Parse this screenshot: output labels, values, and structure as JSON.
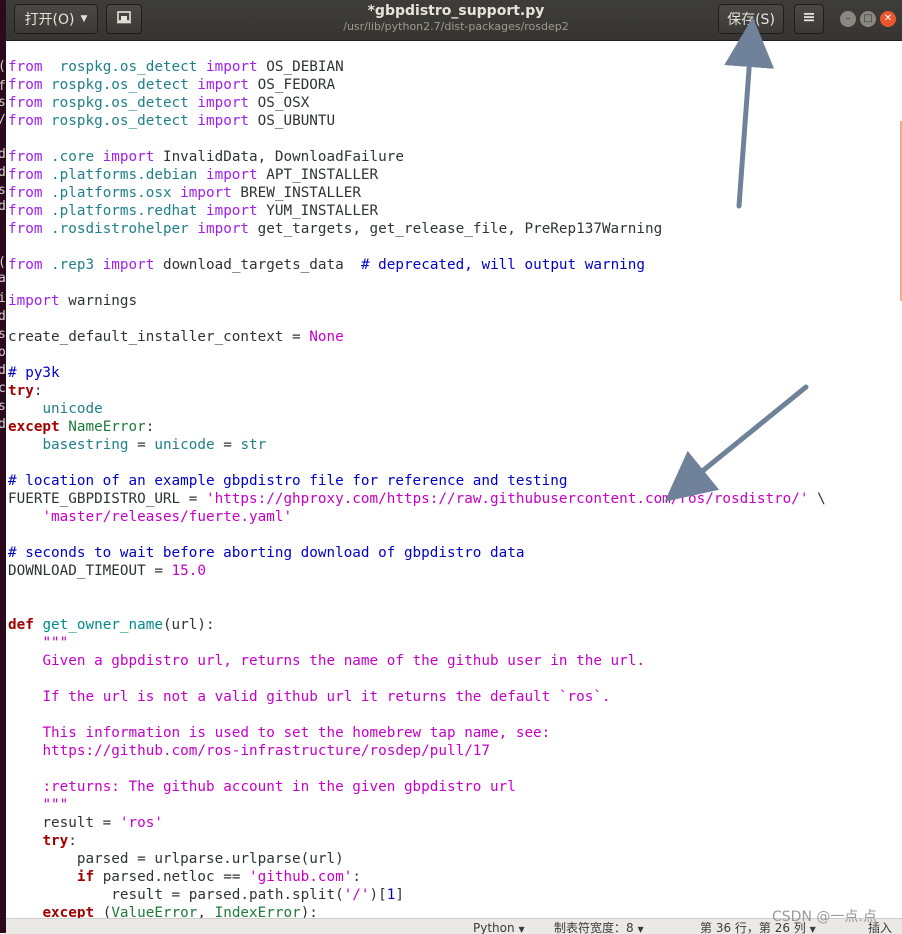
{
  "window": {
    "title": "*gbpdistro_support.py",
    "path": "/usr/lib/python2.7/dist-packages/rosdep2"
  },
  "toolbar": {
    "open_label": "打开(O)",
    "save_label": "保存(S)"
  },
  "icons": {
    "open_caret": "chevron-down-icon",
    "pin": "pin-document-icon",
    "menu": "hamburger-menu-icon",
    "minimize": "minimize-icon",
    "maximize": "maximize-icon",
    "close": "close-icon"
  },
  "left_strip_glyphs": [
    "(",
    "f",
    "s",
    "/",
    "d",
    "d",
    "s",
    "d",
    "(",
    "a",
    "i",
    "d",
    "s",
    "o",
    "d",
    "c",
    "s",
    "d"
  ],
  "code_lines": [
    [
      [
        "im",
        "from"
      ],
      [
        "",
        "  "
      ],
      [
        "mod",
        "rospkg.os_detect"
      ],
      [
        "",
        ""
      ],
      [
        "im",
        " import"
      ],
      [
        "",
        " OS_DEBIAN"
      ]
    ],
    [
      [
        "im",
        "from"
      ],
      [
        "",
        " "
      ],
      [
        "mod",
        "rospkg.os_detect"
      ],
      [
        "im",
        " import"
      ],
      [
        "",
        " OS_FEDORA"
      ]
    ],
    [
      [
        "im",
        "from"
      ],
      [
        "",
        " "
      ],
      [
        "mod",
        "rospkg.os_detect"
      ],
      [
        "im",
        " import"
      ],
      [
        "",
        " OS_OSX"
      ]
    ],
    [
      [
        "im",
        "from"
      ],
      [
        "",
        " "
      ],
      [
        "mod",
        "rospkg.os_detect"
      ],
      [
        "im",
        " import"
      ],
      [
        "",
        " OS_UBUNTU"
      ]
    ],
    [],
    [
      [
        "im",
        "from"
      ],
      [
        "",
        " "
      ],
      [
        "mod",
        ".core"
      ],
      [
        "im",
        " import"
      ],
      [
        "",
        " InvalidData, DownloadFailure"
      ]
    ],
    [
      [
        "im",
        "from"
      ],
      [
        "",
        " "
      ],
      [
        "mod",
        ".platforms.debian"
      ],
      [
        "im",
        " import"
      ],
      [
        "",
        " APT_INSTALLER"
      ]
    ],
    [
      [
        "im",
        "from"
      ],
      [
        "",
        " "
      ],
      [
        "mod",
        ".platforms.osx"
      ],
      [
        "im",
        " import"
      ],
      [
        "",
        " BREW_INSTALLER"
      ]
    ],
    [
      [
        "im",
        "from"
      ],
      [
        "",
        " "
      ],
      [
        "mod",
        ".platforms.redhat"
      ],
      [
        "im",
        " import"
      ],
      [
        "",
        " YUM_INSTALLER"
      ]
    ],
    [
      [
        "im",
        "from"
      ],
      [
        "",
        " "
      ],
      [
        "mod",
        ".rosdistrohelper"
      ],
      [
        "im",
        " import"
      ],
      [
        "",
        " get_targets, get_release_file, PreRep137Warning"
      ]
    ],
    [],
    [
      [
        "im",
        "from"
      ],
      [
        "",
        " "
      ],
      [
        "mod",
        ".rep3"
      ],
      [
        "im",
        " import"
      ],
      [
        "",
        " download_targets_data  "
      ],
      [
        "cm",
        "# deprecated, will output warning"
      ]
    ],
    [],
    [
      [
        "im",
        "import"
      ],
      [
        "",
        " warnings"
      ]
    ],
    [],
    [
      [
        "",
        "create_default_installer_context = "
      ],
      [
        "cst",
        "None"
      ]
    ],
    [],
    [
      [
        "cm",
        "# py3k"
      ]
    ],
    [
      [
        "kw",
        "try"
      ],
      [
        "",
        ":"
      ]
    ],
    [
      [
        "",
        "    "
      ],
      [
        "mod",
        "unicode"
      ]
    ],
    [
      [
        "kw",
        "except"
      ],
      [
        "",
        " "
      ],
      [
        "exc",
        "NameError"
      ],
      [
        "",
        ":"
      ]
    ],
    [
      [
        "",
        "    "
      ],
      [
        "mod",
        "basestring"
      ],
      [
        "",
        " = "
      ],
      [
        "mod",
        "unicode"
      ],
      [
        "",
        " = "
      ],
      [
        "mod",
        "str"
      ]
    ],
    [],
    [
      [
        "cm",
        "# location of an example gbpdistro file for reference and testing"
      ]
    ],
    [
      [
        "",
        "FUERTE_GBPDISTRO_URL = "
      ],
      [
        "str",
        "'https://ghproxy.com/https://raw.githubusercontent.com/ros/rosdistro/'"
      ],
      [
        "",
        " \\"
      ]
    ],
    [
      [
        "",
        "    "
      ],
      [
        "str",
        "'master/releases/fuerte.yaml'"
      ]
    ],
    [],
    [
      [
        "cm",
        "# seconds to wait before aborting download of gbpdistro data"
      ]
    ],
    [
      [
        "",
        "DOWNLOAD_TIMEOUT = "
      ],
      [
        "cst",
        "15.0"
      ]
    ],
    [],
    [],
    [
      [
        "kw",
        "def"
      ],
      [
        "",
        " "
      ],
      [
        "fn",
        "get_owner_name"
      ],
      [
        "",
        "(url):"
      ]
    ],
    [
      [
        "",
        "    "
      ],
      [
        "str",
        "\"\"\""
      ]
    ],
    [
      [
        "",
        "    "
      ],
      [
        "str",
        "Given a gbpdistro url, returns the name of the github user in the url."
      ]
    ],
    [],
    [
      [
        "",
        "    "
      ],
      [
        "str",
        "If the url is not a valid github url it returns the default `ros`."
      ]
    ],
    [],
    [
      [
        "",
        "    "
      ],
      [
        "str",
        "This information is used to set the homebrew tap name, see:"
      ]
    ],
    [
      [
        "",
        "    "
      ],
      [
        "str",
        "https://github.com/ros-infrastructure/rosdep/pull/17"
      ]
    ],
    [],
    [
      [
        "",
        "    "
      ],
      [
        "str",
        ":returns: The github account in the given gbpdistro url"
      ]
    ],
    [
      [
        "",
        "    "
      ],
      [
        "str",
        "\"\"\""
      ]
    ],
    [
      [
        "",
        "    result = "
      ],
      [
        "str",
        "'ros'"
      ]
    ],
    [
      [
        "",
        "    "
      ],
      [
        "kw",
        "try"
      ],
      [
        "",
        ":"
      ]
    ],
    [
      [
        "",
        "        parsed = urlparse.urlparse(url)"
      ]
    ],
    [
      [
        "",
        "        "
      ],
      [
        "kw",
        "if"
      ],
      [
        "",
        " parsed.netloc == "
      ],
      [
        "str",
        "'github.com'"
      ],
      [
        "",
        ":"
      ]
    ],
    [
      [
        "",
        "            result = parsed.path.split("
      ],
      [
        "str",
        "'/'"
      ],
      [
        "",
        ")["
      ],
      [
        "cm",
        "1"
      ],
      [
        "",
        "]"
      ]
    ],
    [
      [
        "",
        "    "
      ],
      [
        "kw",
        "except"
      ],
      [
        "",
        " ("
      ],
      [
        "exc",
        "ValueError"
      ],
      [
        "",
        ", "
      ],
      [
        "exc",
        "IndexError"
      ],
      [
        "",
        "):"
      ]
    ]
  ],
  "statusbar": {
    "language": "Python",
    "tab_width": "制表符宽度：8",
    "position_line": "第 36 行，第 26 列",
    "insert_mode": "插入"
  },
  "watermark": "CSDN @一点.点",
  "colors": {
    "header_bg": "#3c3b37",
    "keyword": "#a40000",
    "import": "#a020f0",
    "module": "#20808a",
    "string": "#c700c7",
    "comment": "#0000c8",
    "close_button": "#e9582c",
    "arrow": "#6f8299"
  }
}
